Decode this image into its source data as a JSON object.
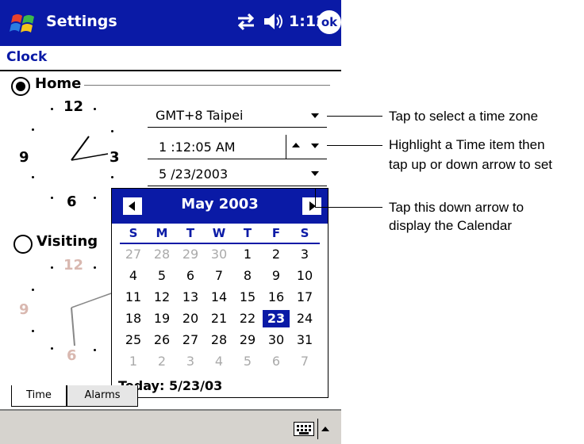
{
  "titlebar": {
    "app_name": "Settings",
    "time": "1:12",
    "ok_label": "ok"
  },
  "page_title": "Clock",
  "home": {
    "label": "Home",
    "timezone": "GMT+8 Taipei",
    "time": "1 :12:05 AM",
    "date": "5 /23/2003",
    "clock_numbers": [
      "12",
      "3",
      "6",
      "9"
    ]
  },
  "visiting": {
    "label": "Visiting",
    "clock_numbers": [
      "12",
      "9",
      "6"
    ]
  },
  "calendar": {
    "month_year": "May 2003",
    "weekdays": [
      "S",
      "M",
      "T",
      "W",
      "T",
      "F",
      "S"
    ],
    "weeks": [
      [
        "27",
        "28",
        "29",
        "30",
        "1",
        "2",
        "3"
      ],
      [
        "4",
        "5",
        "6",
        "7",
        "8",
        "9",
        "10"
      ],
      [
        "11",
        "12",
        "13",
        "14",
        "15",
        "16",
        "17"
      ],
      [
        "18",
        "19",
        "20",
        "21",
        "22",
        "23",
        "24"
      ],
      [
        "25",
        "26",
        "27",
        "28",
        "29",
        "30",
        "31"
      ],
      [
        "1",
        "2",
        "3",
        "4",
        "5",
        "6",
        "7"
      ]
    ],
    "selected_day": "23",
    "today_label": "Today: 5/23/03"
  },
  "tabs": [
    "Time",
    "Alarms"
  ],
  "callouts": {
    "timezone": "Tap to select a time zone",
    "time_line1": "Highlight a Time item then",
    "time_line2": "tap up or down arrow to set",
    "calendar_line1": "Tap this down arrow to",
    "calendar_line2": "display the Calendar"
  },
  "colors": {
    "accent": "#0a1aa6",
    "command_bar": "#d6d3ce",
    "other_month_day": "#aaaaaa"
  }
}
